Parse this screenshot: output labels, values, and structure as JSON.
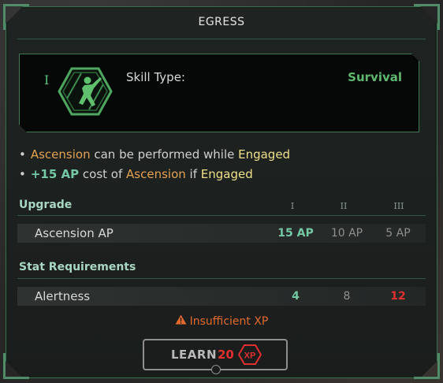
{
  "title": "EGRESS",
  "skill": {
    "tier": "I",
    "type_label": "Skill Type:",
    "type_value": "Survival",
    "icon": "running-figure-shield-icon"
  },
  "bullets": [
    {
      "parts": [
        "Ascension",
        " can be performed while ",
        "Engaged"
      ]
    },
    {
      "parts": [
        "+15 AP",
        " cost of ",
        "Ascension",
        " if ",
        "Engaged"
      ]
    }
  ],
  "upgrade": {
    "heading": "Upgrade",
    "tiers": [
      "I",
      "II",
      "III"
    ],
    "rows": [
      {
        "label": "Ascension AP",
        "values": [
          "15 AP",
          "10 AP",
          "5 AP"
        ]
      }
    ]
  },
  "requirements": {
    "heading": "Stat Requirements",
    "rows": [
      {
        "label": "Alertness",
        "values": [
          "4",
          "8",
          "12"
        ]
      }
    ]
  },
  "warning": "Insufficient XP",
  "learn": {
    "label": "LEARN",
    "cost": "20",
    "currency": "XP"
  },
  "colors": {
    "accent_green": "#5fb86d",
    "orange": "#e4a150",
    "yellow": "#efe08a",
    "teal": "#74c8a3",
    "red": "#e0302f"
  }
}
